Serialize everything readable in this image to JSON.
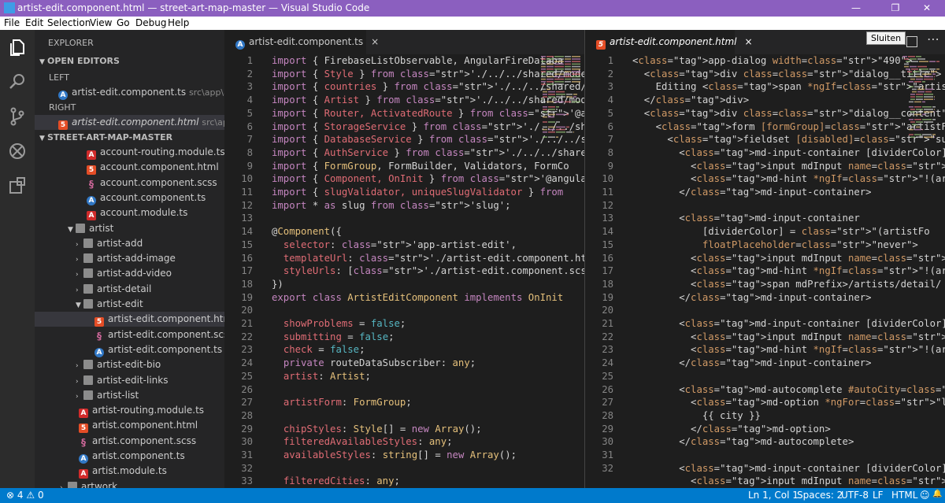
{
  "window": {
    "title": "artist-edit.component.html — street-art-map-master — Visual Studio Code",
    "controls": [
      "—",
      "❐",
      "✕"
    ]
  },
  "menu": [
    "File",
    "Edit",
    "Selection",
    "View",
    "Go",
    "Debug",
    "Help"
  ],
  "sidebar": {
    "explorer_label": "EXPLORER",
    "open_editors_label": "OPEN EDITORS",
    "left_label": "LEFT",
    "left_file": "artist-edit.component.ts",
    "left_path": "src\\app\\artis...",
    "right_label": "RIGHT",
    "right_file": "artist-edit.component.html",
    "right_path": "src\\app\\ar...",
    "project_label": "STREET-ART-MAP-MASTER",
    "tree": [
      {
        "label": "account-routing.module.ts",
        "icon": "ng"
      },
      {
        "label": "account.component.html",
        "icon": "html"
      },
      {
        "label": "account.component.scss",
        "icon": "scss"
      },
      {
        "label": "account.component.ts",
        "icon": "ts"
      },
      {
        "label": "account.module.ts",
        "icon": "ng"
      },
      {
        "label": "artist",
        "icon": "folder"
      },
      {
        "label": "artist-add",
        "icon": "folder"
      },
      {
        "label": "artist-add-image",
        "icon": "folder"
      },
      {
        "label": "artist-add-video",
        "icon": "folder"
      },
      {
        "label": "artist-detail",
        "icon": "folder"
      },
      {
        "label": "artist-edit",
        "icon": "folder"
      },
      {
        "label": "artist-edit.component.html",
        "icon": "html"
      },
      {
        "label": "artist-edit.component.scss",
        "icon": "scss"
      },
      {
        "label": "artist-edit.component.ts",
        "icon": "ts"
      },
      {
        "label": "artist-edit-bio",
        "icon": "folder"
      },
      {
        "label": "artist-edit-links",
        "icon": "folder"
      },
      {
        "label": "artist-list",
        "icon": "folder"
      },
      {
        "label": "artist-routing.module.ts",
        "icon": "ng"
      },
      {
        "label": "artist.component.html",
        "icon": "html"
      },
      {
        "label": "artist.component.scss",
        "icon": "scss"
      },
      {
        "label": "artist.component.ts",
        "icon": "ts"
      },
      {
        "label": "artist.module.ts",
        "icon": "ng"
      },
      {
        "label": "artwork",
        "icon": "folder"
      }
    ]
  },
  "left_editor": {
    "tab_label": "artist-edit.component.ts",
    "tab_close": "×",
    "line_numbers": [
      "1",
      "2",
      "3",
      "4",
      "5",
      "6",
      "7",
      "8",
      "9",
      "10",
      "11",
      "12",
      "13",
      "14",
      "15",
      "16",
      "17",
      "18",
      "19",
      "20",
      "21",
      "22",
      "23",
      "24",
      "25",
      "26",
      "27",
      "28",
      "29",
      "30",
      "31",
      "32",
      "33"
    ],
    "lines": [
      "import { FirebaseListObservable, AngularFireDataba",
      "import { Style } from './../../shared/models/style.",
      "import { countries } from './../../shared/data/cou",
      "import { Artist } from './../../shared/models/artis",
      "import { Router, ActivatedRoute } from '@angular/ro",
      "import { StorageService } from './../../shared/serv",
      "import { DatabaseService } from './../../shared/ser",
      "import { AuthService } from './../../shared/service",
      "import { FormGroup, FormBuilder, Validators, FormCo",
      "import { Component, OnInit } from '@angular/core';",
      "import { slugValidator, uniqueSlugValidator } from",
      "import * as slug from 'slug';",
      "",
      "@Component({",
      "  selector: 'app-artist-edit',",
      "  templateUrl: './artist-edit.component.html',",
      "  styleUrls: ['./artist-edit.component.scss']",
      "})",
      "export class ArtistEditComponent implements OnInit",
      "",
      "  showProblems = false;",
      "  submitting = false;",
      "  check = false;",
      "  private routeDataSubscriber: any;",
      "  artist: Artist;",
      "",
      "  artistForm: FormGroup;",
      "",
      "  chipStyles: Style[] = new Array();",
      "  filteredAvailableStyles: any;",
      "  availableStyles: string[] = new Array();",
      "",
      "  filteredCities: any;"
    ]
  },
  "right_editor": {
    "tab_label": "artist-edit.component.html",
    "tab_close": "×",
    "tooltip": "Sluiten",
    "line_numbers": [
      "1",
      "2",
      "3",
      "4",
      "5",
      "6",
      "7",
      "8",
      "9",
      "10",
      "11",
      "12",
      "13",
      "14",
      "15",
      "16",
      "17",
      "18",
      "19",
      "20",
      "21",
      "22",
      "23",
      "24",
      "25",
      "26",
      "27",
      "28",
      "29",
      "30",
      "31",
      "32"
    ],
    "lines": [
      "<app-dialog width=\"490\">",
      "  <div class=\"dialog__title\">",
      "    Editing <span *ngIf=\"artist\">{{ artist.name",
      "  </div>",
      "  <div class=\"dialog__content\">",
      "    <form [formGroup]=\"artistForm\" (keydown)=\"s",
      "      <fieldset [disabled]=\"submitting || (!s",
      "        <md-input-container [dividerColor]",
      "          <input mdInput name=\"name\" plac",
      "          <md-hint *ngIf=\"!(artistForm.co",
      "        </md-input-container>",
      "",
      "        <md-input-container",
      "            [dividerColor] = \"(artistFo",
      "            floatPlaceholder=\"never\">",
      "          <input mdInput name=\"slug\" [fo",
      "          <md-hint *ngIf=\"!(artistForm.co",
      "          <span mdPrefix>/artists/detail/",
      "        </md-input-container>",
      "",
      "        <md-input-container [dividerColor]",
      "          <input mdInput name=\"city\" plac",
      "          <md-hint *ngIf=\"!(artistForm.co",
      "        </md-input-container>",
      "",
      "        <md-autocomplete #autoCity=\"mdAuto",
      "          <md-option *ngFor=\"let city of",
      "            {{ city }}",
      "          </md-option>",
      "        </md-autocomplete>",
      "",
      "        <md-input-container [dividerColor]",
      "          <input mdInput name=\"country\" p"
    ]
  },
  "status": {
    "errors": "4",
    "warnings": "0",
    "position": "Ln 1, Col 1",
    "spaces": "Spaces: 2",
    "encoding": "UTF-8",
    "eol": "LF",
    "language": "HTML",
    "feedback": "☺",
    "bell": "🔔"
  },
  "colors": {
    "titlebar": "#8b5fbf",
    "statusbar": "#007acc",
    "editor_bg": "#1e1e1e"
  }
}
